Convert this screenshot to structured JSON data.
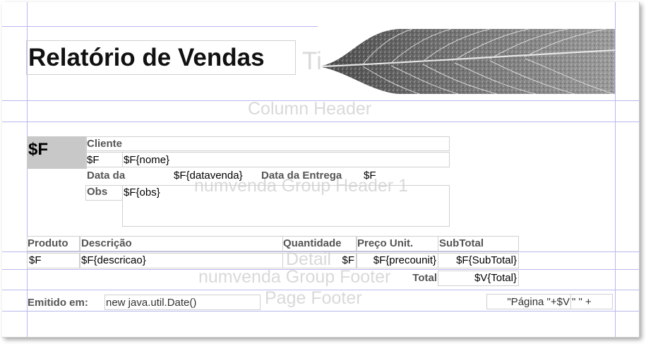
{
  "title": {
    "text": "Relatório de Vendas",
    "band_label": "Ti"
  },
  "bands": {
    "column_header": "Column Header",
    "group_header": "numvenda Group Header 1",
    "detail": "Detail",
    "group_footer": "numvenda Group Footer",
    "page_footer": "Page Footer"
  },
  "group_header": {
    "numvenda_field": "$F",
    "cliente_label": "Cliente",
    "cliente_id_field": "$F",
    "nome_field": "$F{nome}",
    "data_venda_label": "Data da",
    "data_venda_field": "$F{datavenda}",
    "data_entrega_label": "Data da Entrega",
    "data_entrega_field": "$F",
    "obs_label": "Obs",
    "obs_field": "$F{obs}"
  },
  "columns": {
    "produto": "Produto",
    "descricao": "Descrição",
    "quantidade": "Quantidade",
    "preco_unit": "Preço Unit.",
    "subtotal": "SubTotal"
  },
  "detail": {
    "produto": "$F",
    "descricao": "$F{descricao}",
    "quantidade": "$F",
    "precounit": "$F{precounit}",
    "subtotal": "$F{SubTotal}"
  },
  "group_footer": {
    "total_label": "Total",
    "total_field": "$V{Total}"
  },
  "page_footer": {
    "emitido_label": "Emitido em:",
    "date_expression": "new java.util.Date()",
    "page_expression": "\"Página \"+$V",
    "page_expression_2": "\" \" +"
  }
}
